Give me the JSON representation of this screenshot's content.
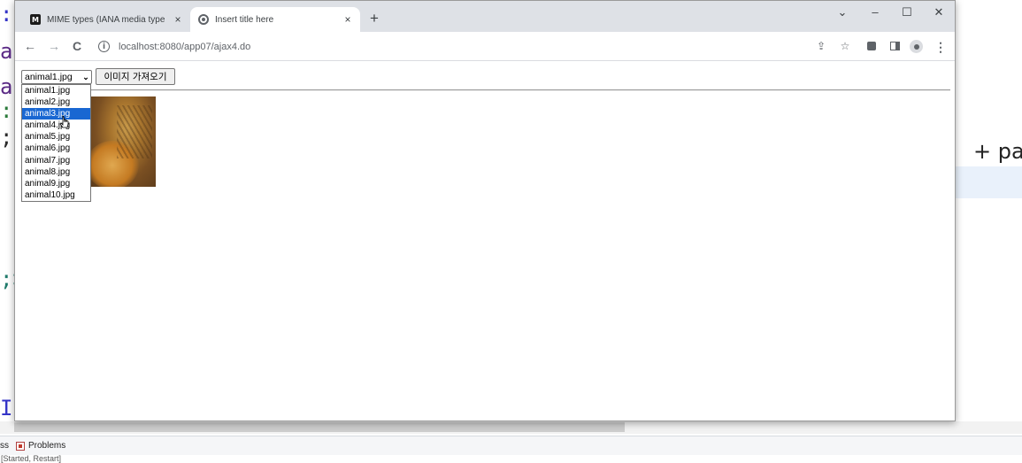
{
  "ide": {
    "code_fragments": [
      {
        "text": ":b",
        "color": "#3535c8"
      },
      {
        "text": "ar",
        "color": "#5b2a86"
      },
      {
        "text": "ar",
        "color": "#5b2a86"
      },
      {
        "text": ":\"",
        "color": "#2a7a3a"
      },
      {
        "text": ";,",
        "color": "#2a2a2a"
      },
      {
        "text": ";>",
        "color": "#1f7a6a"
      },
      {
        "text": "ID",
        "color": "#3535c8"
      }
    ],
    "right_text": "+ pa",
    "tabs_fragment": "ss",
    "problems_label": "Problems",
    "status_text": "[Started, Restart]"
  },
  "browser": {
    "tabs": [
      {
        "title": "MIME types (IANA media type",
        "favicon": "mdn-icon",
        "favicon_text": "M",
        "close": "×"
      },
      {
        "title": "Insert title here",
        "favicon": "globe-icon",
        "close": "×"
      }
    ],
    "new_tab": "+",
    "window_controls": {
      "chevron": "⌄",
      "minimize": "–",
      "maximize": "☐",
      "close": "✕"
    },
    "nav": {
      "back": "←",
      "forward": "→",
      "reload": "C"
    },
    "info_icon": "i",
    "url": "localhost:8080/app07/ajax4.do",
    "toolbar_icons": {
      "share": "⇪",
      "bookmark": "☆",
      "menu": "⋮"
    }
  },
  "page": {
    "select": {
      "value": "animal1.jpg",
      "arrow": "⌄",
      "options": [
        "animal1.jpg",
        "animal2.jpg",
        "animal3.jpg",
        "animal4.jpg",
        "animal5.jpg",
        "animal6.jpg",
        "animal7.jpg",
        "animal8.jpg",
        "animal9.jpg",
        "animal10.jpg"
      ],
      "highlighted_index": 2
    },
    "fetch_button": "이미지 가져오기"
  }
}
